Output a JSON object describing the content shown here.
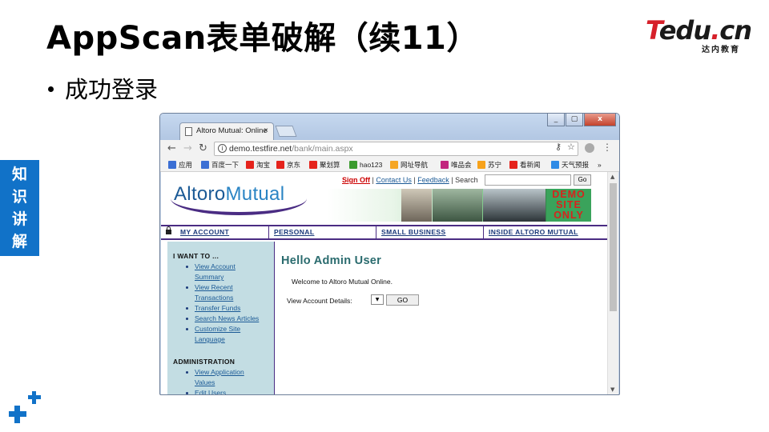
{
  "slide": {
    "title": "AppScan表单破解（续11）",
    "bullet": "成功登录",
    "side_tab": [
      "知",
      "识",
      "讲",
      "解"
    ]
  },
  "logo": {
    "t": "T",
    "rest": "edu",
    "dot": ".",
    "cn": "cn",
    "sub": "达内教育"
  },
  "browser": {
    "tab_title": "Altoro Mutual: Online",
    "tab_close": "×",
    "url_host": "demo.testfire.net",
    "url_path": "/bank/main.aspx",
    "window_buttons": [
      "_",
      "▢",
      "x"
    ],
    "bookmarks": [
      {
        "label": "应用",
        "color": "#3b6fd4"
      },
      {
        "label": "百度一下",
        "color": "#3b6fd4"
      },
      {
        "label": "淘宝",
        "color": "#e5231c"
      },
      {
        "label": "京东",
        "color": "#e5231c"
      },
      {
        "label": "聚划算",
        "color": "#e5231c"
      },
      {
        "label": "hao123",
        "color": "#3b9b2f"
      },
      {
        "label": "网址导航",
        "color": "#f6a623"
      },
      {
        "label": "唯品会",
        "color": "#c2267e"
      },
      {
        "label": "苏宁",
        "color": "#f7a21b"
      },
      {
        "label": "看新闻",
        "color": "#e5231c"
      },
      {
        "label": "天气预报",
        "color": "#2e8be6"
      },
      {
        "label": "»",
        "color": ""
      }
    ]
  },
  "site": {
    "logo_altoro": "Altoro",
    "logo_mutual": "Mutual",
    "sign_off": "Sign Off",
    "contact": "Contact Us",
    "feedback": "Feedback",
    "search_label": "Search",
    "go_top": "Go",
    "demo_stamp": [
      "DEMO",
      "SITE",
      "ONLY"
    ],
    "nav": [
      "MY ACCOUNT",
      "PERSONAL",
      "SMALL BUSINESS",
      "INSIDE ALTORO MUTUAL"
    ],
    "sidebar": {
      "heading_1": "I WANT TO ...",
      "links": [
        [
          "View Account",
          "Summary"
        ],
        [
          "View Recent",
          "Transactions"
        ],
        [
          "Transfer Funds"
        ],
        [
          "Search News Articles"
        ],
        [
          "Customize Site",
          "Language"
        ]
      ],
      "heading_2": "ADMINISTRATION",
      "admin_links": [
        [
          "View Application",
          "Values"
        ],
        [
          "Edit Users"
        ]
      ]
    },
    "hello": "Hello Admin User",
    "welcome": "Welcome to Altoro Mutual Online.",
    "account_label": "View Account Details:",
    "select_arrow": "▼",
    "go": "GO"
  },
  "colors": {
    "accent_blue": "#1172c8",
    "brand_red": "#d6202a",
    "nav_purple": "#4a2c83",
    "sidebar_bg": "#c3dde3",
    "heading_teal": "#2a6b6e"
  }
}
